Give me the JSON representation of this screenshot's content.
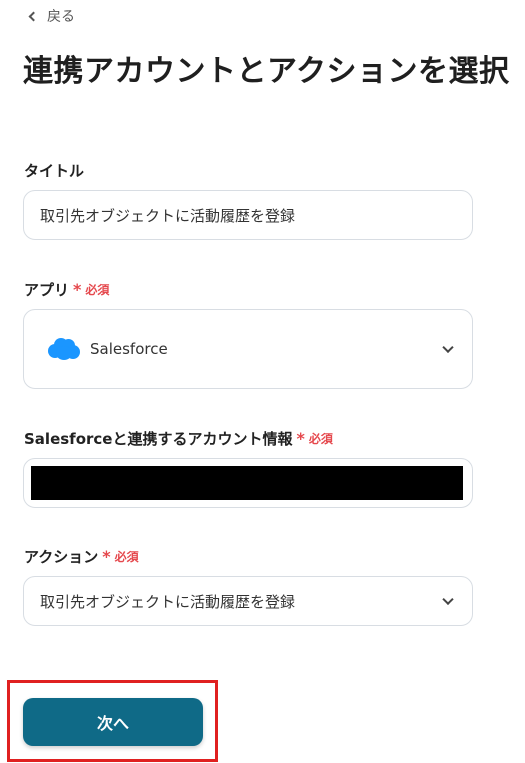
{
  "header": {
    "back_label": "戻る",
    "page_title": "連携アカウントとアクションを選択"
  },
  "form": {
    "title_field": {
      "label": "タイトル",
      "value": "取引先オブジェクトに活動履歴を登録"
    },
    "app_field": {
      "label": "アプリ",
      "required_mark": "*",
      "required_text": "必須",
      "value": "Salesforce",
      "icon": "salesforce-cloud-icon",
      "icon_color": "#1b96ff"
    },
    "account_field": {
      "label": "Salesforceと連携するアカウント情報",
      "required_mark": "*",
      "required_text": "必須"
    },
    "action_field": {
      "label": "アクション",
      "required_mark": "*",
      "required_text": "必須",
      "value": "取引先オブジェクトに活動履歴を登録"
    }
  },
  "footer": {
    "next_label": "次へ",
    "button_color": "#0f6a87",
    "highlight_color": "#e02020"
  }
}
